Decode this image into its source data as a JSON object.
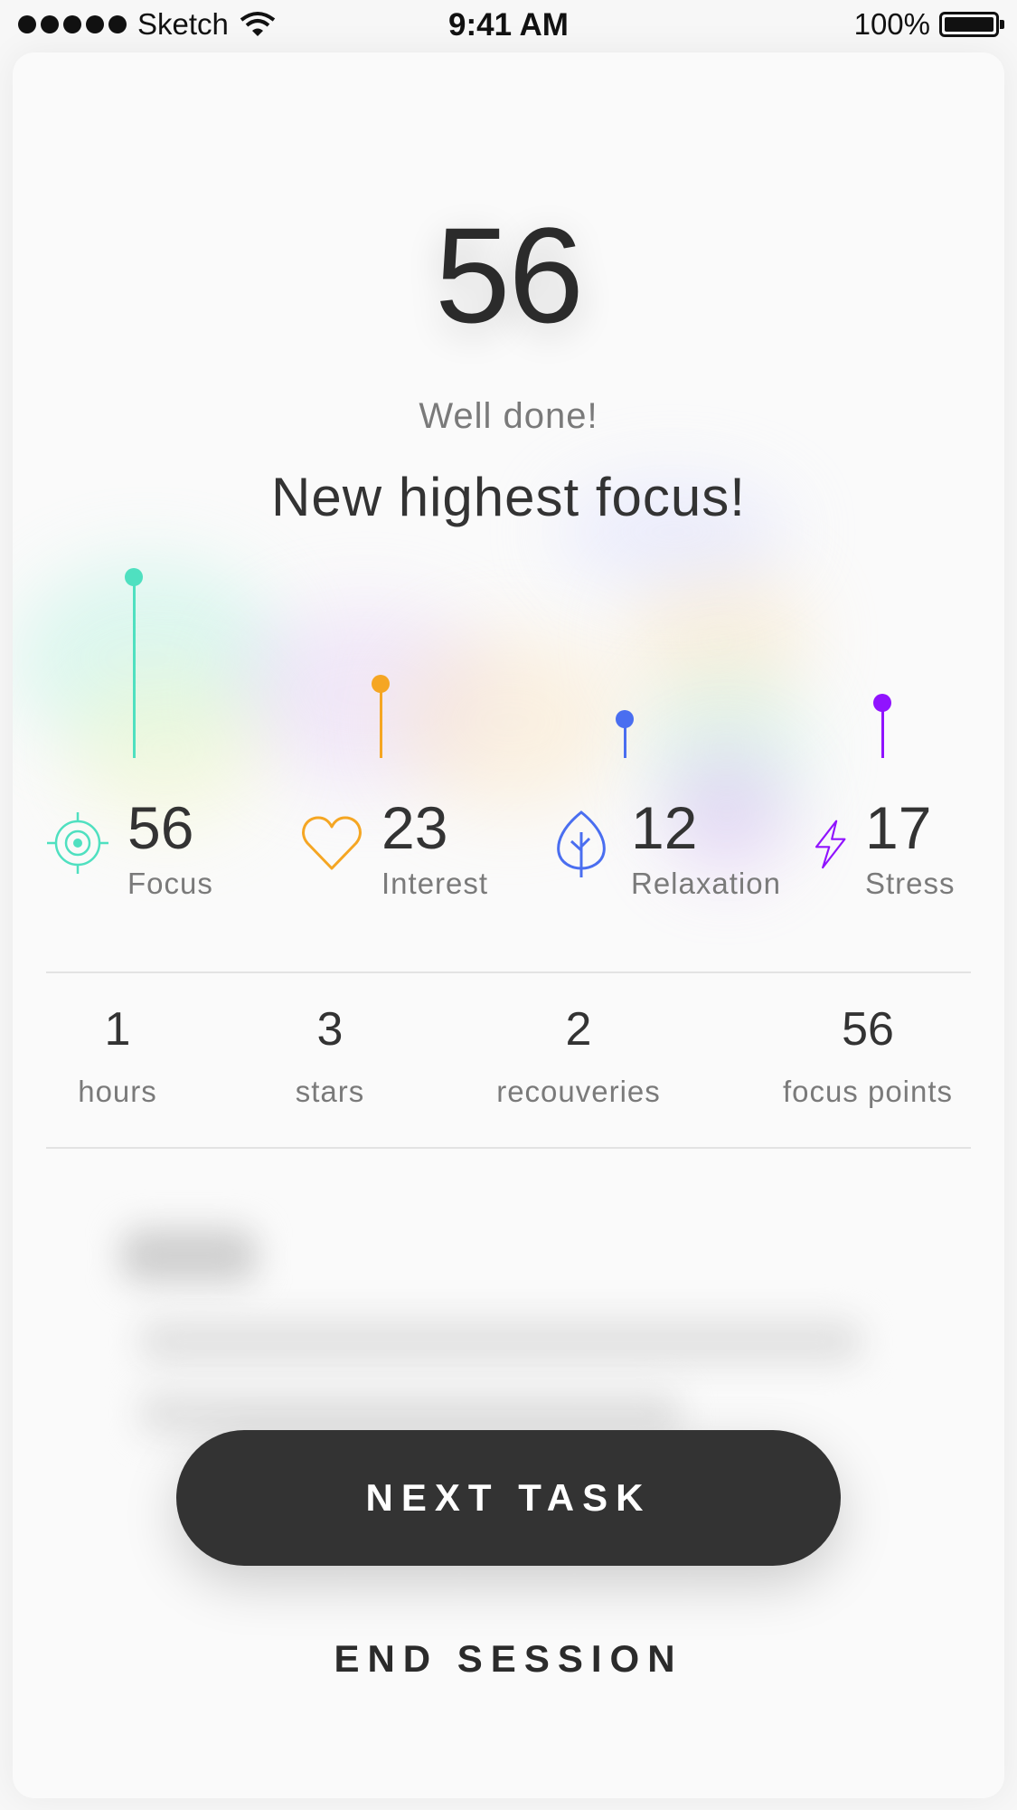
{
  "status_bar": {
    "carrier": "Sketch",
    "time": "9:41 AM",
    "battery": "100%"
  },
  "score": "56",
  "message": "Well done!",
  "headline": "New highest focus!",
  "chart_data": {
    "type": "bar",
    "categories": [
      "Focus",
      "Interest",
      "Relaxation",
      "Stress"
    ],
    "values": [
      56,
      23,
      12,
      17
    ],
    "colors": [
      "#4fe0c0",
      "#f5a623",
      "#4a6ef0",
      "#9013fe"
    ],
    "ylim": [
      0,
      56
    ]
  },
  "metrics": [
    {
      "value": "56",
      "label": "Focus",
      "icon": "target-icon",
      "color": "#4fe0c0"
    },
    {
      "value": "23",
      "label": "Interest",
      "icon": "heart-icon",
      "color": "#f5a623"
    },
    {
      "value": "12",
      "label": "Relaxation",
      "icon": "leaf-icon",
      "color": "#4a6ef0"
    },
    {
      "value": "17",
      "label": "Stress",
      "icon": "lightning-icon",
      "color": "#9013fe"
    }
  ],
  "stats": [
    {
      "value": "1",
      "label": "hours"
    },
    {
      "value": "3",
      "label": "stars"
    },
    {
      "value": "2",
      "label": "recouveries"
    },
    {
      "value": "56",
      "label": "focus points"
    }
  ],
  "buttons": {
    "next": "NEXT TASK",
    "end": "END SESSION"
  }
}
